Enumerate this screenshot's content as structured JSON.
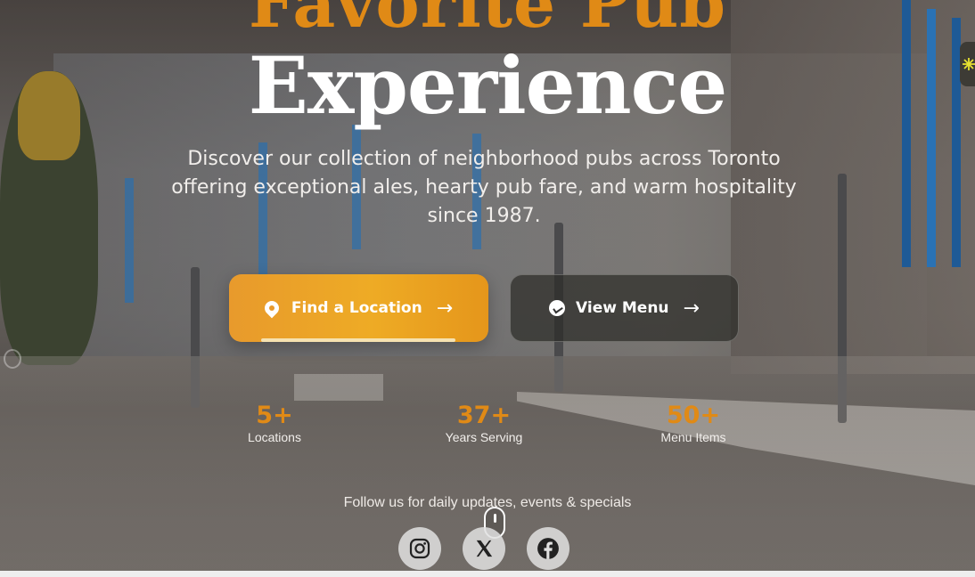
{
  "hero": {
    "title_line1": "Favorite Pub",
    "title_line2": "Experience",
    "subtitle": "Discover our collection of neighborhood pubs across Toronto offering exceptional ales, hearty pub fare, and warm hospitality since 1987.",
    "accent_color": "#e08a16"
  },
  "buttons": {
    "primary": {
      "label": "Find a Location",
      "arrow": "→",
      "icon": "location-pin-icon"
    },
    "secondary": {
      "label": "View Menu",
      "arrow": "→",
      "icon": "menu-icon"
    }
  },
  "stats": [
    {
      "value": "5+",
      "label": "Locations"
    },
    {
      "value": "37+",
      "label": "Years Serving"
    },
    {
      "value": "50+",
      "label": "Menu Items"
    }
  ],
  "social": {
    "heading": "Follow us for daily updates, events & specials",
    "links": [
      {
        "name": "instagram-icon"
      },
      {
        "name": "x-icon"
      },
      {
        "name": "facebook-icon"
      }
    ]
  }
}
